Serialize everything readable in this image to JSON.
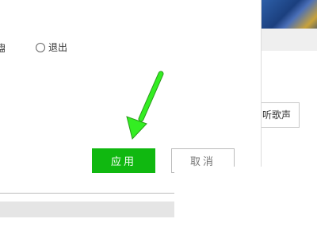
{
  "background": {
    "partial_button_label": "听歌声"
  },
  "dialog": {
    "radio_cut_label": "盘",
    "radio_option_label": "退出",
    "apply_label": "应用",
    "cancel_label": "取消"
  },
  "colors": {
    "apply_green": "#10b810",
    "arrow_green": "#33ee22"
  },
  "icons": {
    "arrow": "annotation-arrow-icon",
    "radio": "radio-unchecked-icon"
  }
}
